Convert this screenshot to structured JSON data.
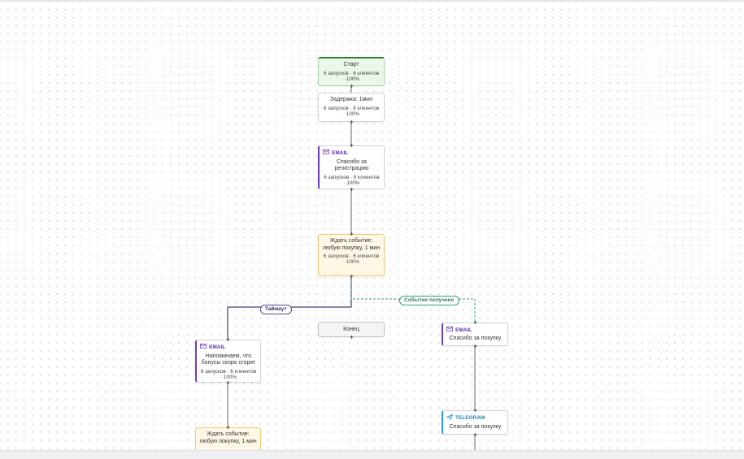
{
  "nodes": {
    "start": {
      "title": "Старт",
      "stats": "6 запусков · 6 клиентов · 100%"
    },
    "delay": {
      "title": "Задержка: 1мин",
      "stats": "6 запусков · 6 клиентов · 100%"
    },
    "email1": {
      "channel": "EMAIL",
      "title": "Спасибо за регистрацию",
      "stats": "6 запусков · 6 клиентов · 100%"
    },
    "wait1": {
      "title": "Ждать событие: любую покупку, 1 мин",
      "stats": "6 запусков · 6 клиентов · 100%"
    },
    "end": {
      "title": "Конец"
    },
    "email2": {
      "channel": "EMAIL",
      "title": "Напоминаем, что бонусы скоро сгорят",
      "stats": "6 запусков · 6 клиентов · 100%"
    },
    "email3": {
      "channel": "EMAIL",
      "title": "Спасибо за покупку"
    },
    "wait2": {
      "title": "Ждать событие: любую покупку, 1 мин"
    },
    "telegram": {
      "channel": "TELEGRAM",
      "title": "Спасибо за покупку"
    }
  },
  "edges": {
    "timeout_label": "Таймаут",
    "event_label": "Событие получено"
  },
  "colors": {
    "email": "#6d3fc0",
    "telegram": "#2a9fd6",
    "start_border": "#2e7d32",
    "wait_bg": "#fff7e6",
    "timeout_edge": "#4a3a7a",
    "event_edge": "#3a9a70"
  },
  "icons": [
    "mail-icon",
    "send-icon"
  ]
}
